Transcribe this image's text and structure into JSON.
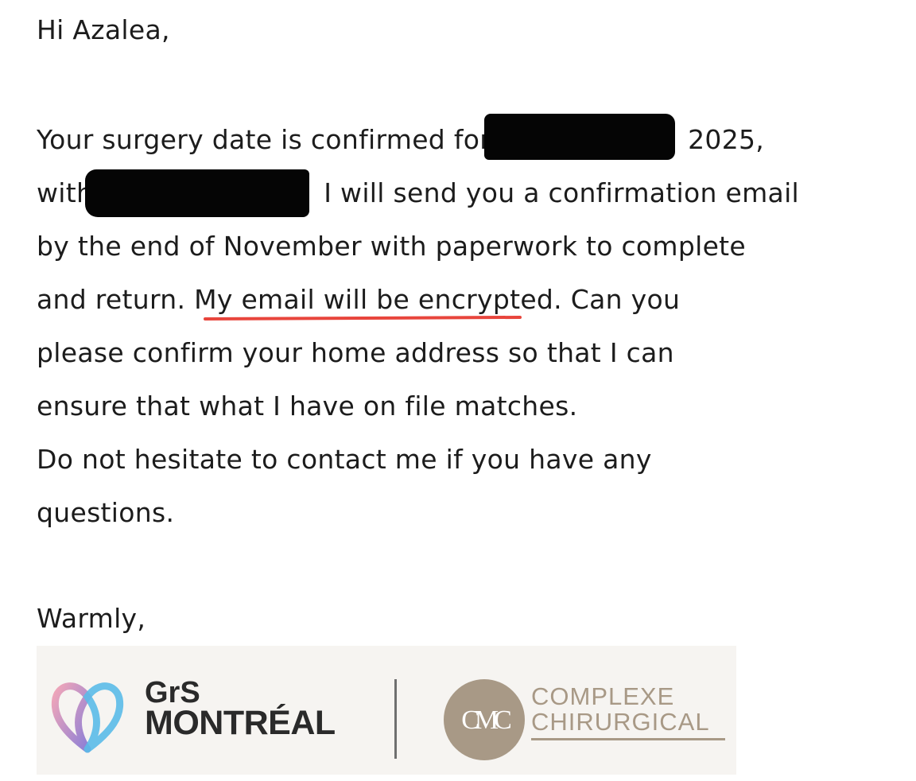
{
  "email": {
    "greeting": "Hi Azalea,",
    "paragraph": {
      "line1_before": "Your surgery date is confirmed for",
      "line1_after": "2025,",
      "line2_before": "with",
      "line2_after": "I will send you a confirmation email",
      "line3": "by the end of November with paperwork to complete",
      "line4_before": "and return. ",
      "line4_underlined": "My email will be encrypted",
      "line4_after": ". Can you",
      "line5": "please confirm your home address so that I can",
      "line6": "ensure that what I have on file matches.",
      "line7": "Do not hesitate to contact me if you have any",
      "line8": "questions."
    },
    "signoff": "Warmly,"
  },
  "signature": {
    "logo1_line1": "GrS",
    "logo1_line2": "MONTRÉAL",
    "logo2_monogram": "CMC",
    "logo2_line1": "COMPLEXE",
    "logo2_line2": "CHIRURGICAL"
  },
  "colors": {
    "underline": "#e8453c",
    "redaction": "#050505",
    "cmc_brand": "#a89986",
    "heart_pink": "#f2a6b8",
    "heart_blue": "#5bbbe8"
  }
}
